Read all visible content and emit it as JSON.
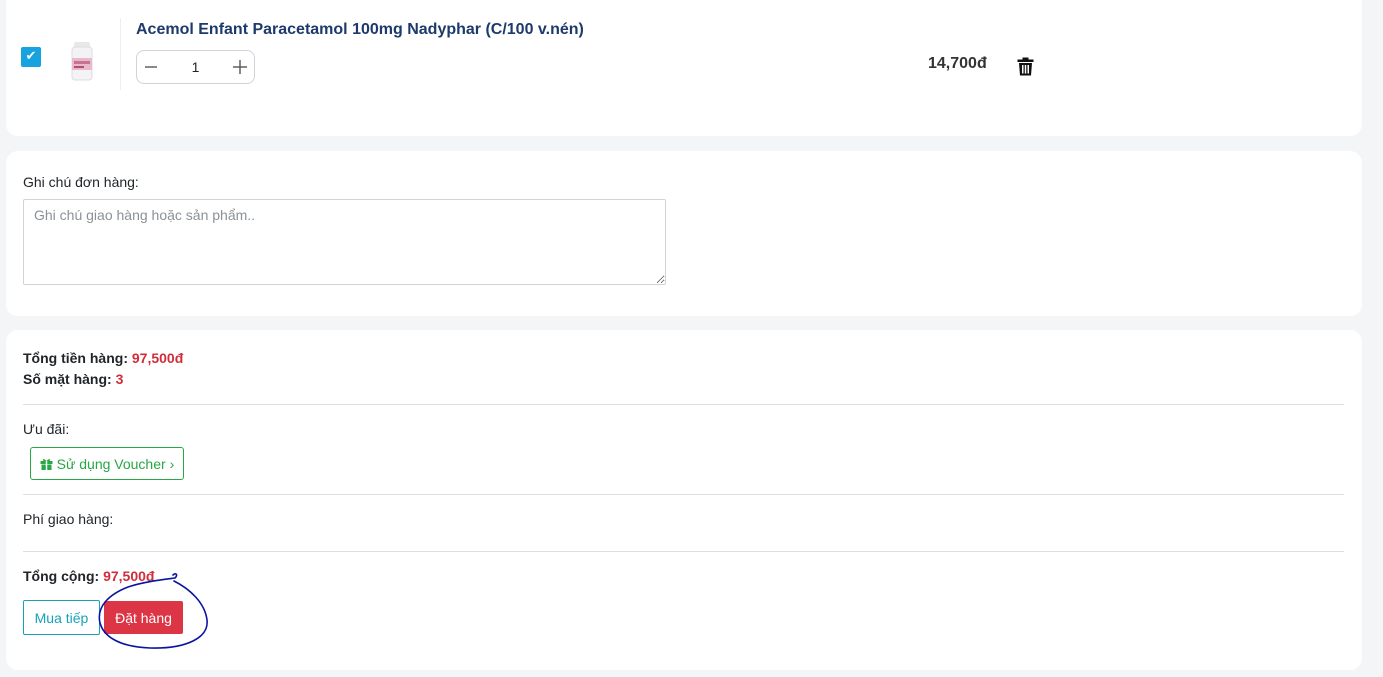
{
  "product": {
    "name": "Acemol Enfant Paracetamol 100mg Nadyphar (C/100 v.nén)",
    "quantity": "1",
    "price": "14,700đ",
    "checked": true,
    "checkbox_icon": "check-icon",
    "minus_icon": "minus-icon",
    "plus_icon": "plus-icon",
    "delete_icon": "trash-icon"
  },
  "note": {
    "label": "Ghi chú đơn hàng:",
    "placeholder": "Ghi chú giao hàng hoặc sản phẩm.."
  },
  "summary": {
    "subtotal_label": "Tổng tiền hàng:",
    "subtotal_value": "97,500đ",
    "item_count_label": "Số mặt hàng:",
    "item_count_value": "3",
    "promo_label": "Ưu đãi:",
    "voucher_button": "Sử dụng Voucher",
    "voucher_icon": "gift-icon",
    "voucher_chevron": "›",
    "shipping_label": "Phí giao hàng:",
    "total_label": "Tổng cộng:",
    "total_value": "97,500đ"
  },
  "actions": {
    "continue_label": "Mua tiếp",
    "order_label": "Đặt hàng"
  },
  "colors": {
    "accent_red": "#dc3545",
    "price_red": "#d12d3a",
    "teal": "#17a2b8",
    "green": "#28a745",
    "checkbox_blue": "#17a2e0",
    "product_title": "#1d3a6b",
    "annotation_ink": "#0a14a0"
  }
}
